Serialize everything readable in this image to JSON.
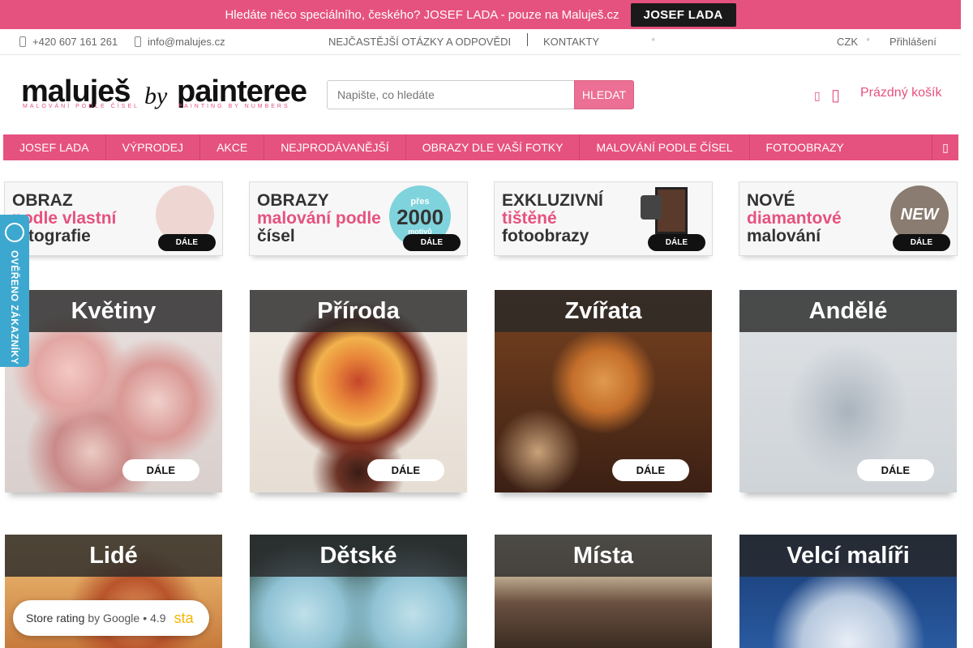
{
  "promo": {
    "text": "Hledáte něco speciálního, českého? JOSEF LADA - pouze na Maluješ.cz",
    "button": "JOSEF LADA"
  },
  "contact": {
    "phone": "+420 607 161 261",
    "email": "info@malujes.cz"
  },
  "infolinks": {
    "faq": "NEJČASTĚJŠÍ OTÁZKY A ODPOVĚDI",
    "contacts": "KONTAKTY",
    "currency": "CZK",
    "login": "Přihlášení"
  },
  "logo": {
    "part1": "maluješ",
    "by": "by",
    "part2": "painteree",
    "sub1": "MALOVÁNÍ PODLE ČÍSEL",
    "sub2": "PAINTING BY NUMBERS"
  },
  "search": {
    "placeholder": "Napište, co hledáte",
    "button": "HLEDAT"
  },
  "cart": {
    "label": "Prázdný košík"
  },
  "nav": [
    {
      "label": "JOSEF LADA"
    },
    {
      "label": "VÝPRODEJ"
    },
    {
      "label": "AKCE"
    },
    {
      "label": "NEJPRODÁVANĚJŠÍ"
    },
    {
      "label": "OBRAZY DLE VAŠÍ FOTKY"
    },
    {
      "label": "MALOVÁNÍ PODLE ČÍSEL"
    },
    {
      "label": "FOTOOBRAZY"
    }
  ],
  "banners": [
    {
      "l1": "OBRAZ",
      "l2": "podle vlastní",
      "l3": "fotografie",
      "cta": "DÁLE"
    },
    {
      "l1": "OBRAZY",
      "l2": "malování podle",
      "l3": "čísel",
      "cta": "DÁLE",
      "circle_top": "přes",
      "circle_num": "2000",
      "circle_bottom": "motivů"
    },
    {
      "l1": "EXKLUZIVNÍ",
      "l2": "tištěné",
      "l3": "fotoobrazy",
      "cta": "DÁLE"
    },
    {
      "l1": "NOVÉ",
      "l2": "diamantové",
      "l3": "malování",
      "cta": "DÁLE",
      "tag": "NEW"
    }
  ],
  "categories": [
    {
      "title": "Květiny",
      "cta": "DÁLE"
    },
    {
      "title": "Příroda",
      "cta": "DÁLE"
    },
    {
      "title": "Zvířata",
      "cta": "DÁLE"
    },
    {
      "title": "Andělé",
      "cta": "DÁLE"
    },
    {
      "title": "Lidé"
    },
    {
      "title": "Dětské"
    },
    {
      "title": "Místa"
    },
    {
      "title": "Velcí malíři"
    }
  ],
  "badge": {
    "label": "OVĚŘENO ZÁKAZNÍKY"
  },
  "rating": {
    "label": "Store rating",
    "by": "by Google",
    "dot": "•",
    "score": "4.9",
    "stars": "sta"
  },
  "colors": {
    "brand": "#e6527f",
    "badge": "#3da8cf"
  }
}
